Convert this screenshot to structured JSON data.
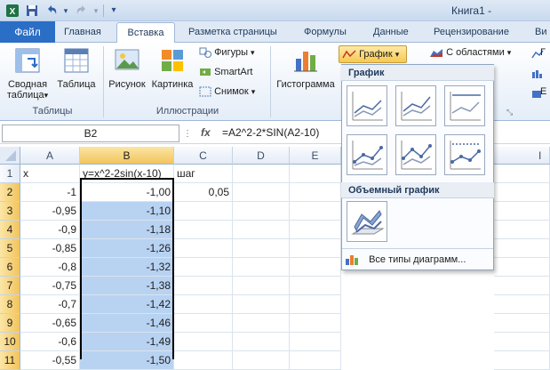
{
  "window": {
    "title": "Книга1 -"
  },
  "quick_access": {
    "save_icon": "save-icon",
    "undo_icon": "undo-icon",
    "redo_icon": "redo-icon"
  },
  "tabs": [
    {
      "label": "Файл"
    },
    {
      "label": "Главная"
    },
    {
      "label": "Вставка"
    },
    {
      "label": "Разметка страницы"
    },
    {
      "label": "Формулы"
    },
    {
      "label": "Данные"
    },
    {
      "label": "Рецензирование"
    },
    {
      "label": "Ви"
    }
  ],
  "ribbon": {
    "pivot_label_1": "Сводная",
    "pivot_label_2": "таблица",
    "pivot_arrow": "▾",
    "table_label": "Таблица",
    "picture_label": "Рисунок",
    "clipart_label": "Картинка",
    "shapes_label": "Фигуры",
    "smartart_label": "SmartArt",
    "screenshot_label": "Снимок",
    "histogram_label": "Гистограмма",
    "chart_button_label": "График",
    "area_label": "С областями",
    "group_tables": "Таблицы",
    "group_illustrations": "Иллюстрации",
    "dropdown_arrow": "▾"
  },
  "formula_bar": {
    "name_box": "B2",
    "fx": "fx",
    "formula": "=A2^2-2*SIN(A2-10)"
  },
  "columns": [
    "A",
    "B",
    "C",
    "D",
    "E",
    "I"
  ],
  "rows": [
    {
      "n": "1",
      "a": "x",
      "b": "y=x^2-2sin(x-10)",
      "c": "шаг"
    },
    {
      "n": "2",
      "a": "-1",
      "b": "-1,00",
      "c": "0,05"
    },
    {
      "n": "3",
      "a": "-0,95",
      "b": "-1,10",
      "c": ""
    },
    {
      "n": "4",
      "a": "-0,9",
      "b": "-1,18",
      "c": ""
    },
    {
      "n": "5",
      "a": "-0,85",
      "b": "-1,26",
      "c": ""
    },
    {
      "n": "6",
      "a": "-0,8",
      "b": "-1,32",
      "c": ""
    },
    {
      "n": "7",
      "a": "-0,75",
      "b": "-1,38",
      "c": ""
    },
    {
      "n": "8",
      "a": "-0,7",
      "b": "-1,42",
      "c": ""
    },
    {
      "n": "9",
      "a": "-0,65",
      "b": "-1,46",
      "c": ""
    },
    {
      "n": "10",
      "a": "-0,6",
      "b": "-1,49",
      "c": ""
    },
    {
      "n": "11",
      "a": "-0,55",
      "b": "-1,50",
      "c": ""
    }
  ],
  "dropdown": {
    "section_2d": "График",
    "section_3d": "Объемный график",
    "all_types": "Все типы диаграмм..."
  },
  "colors": {
    "file_tab": "#2a6ec6",
    "selection": "#b8d2f2",
    "header_selected": "#f2c45c"
  }
}
